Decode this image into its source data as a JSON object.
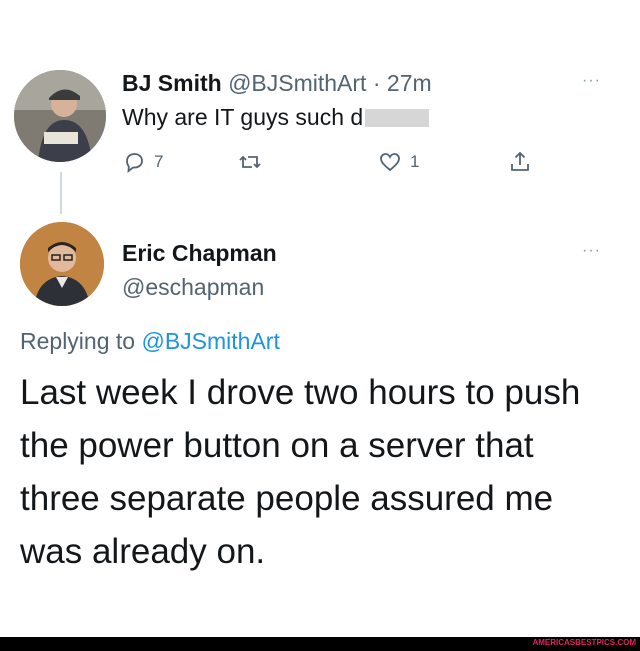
{
  "tweet1": {
    "name": "BJ Smith",
    "handle": "@BJSmithArt",
    "separator": "·",
    "time": "27m",
    "text": "Why are IT guys such d",
    "more": "···",
    "replies": "7",
    "likes": "1"
  },
  "tweet2": {
    "name": "Eric Chapman",
    "handle": "@eschapman",
    "more": "···",
    "replying_prefix": "Replying to",
    "replying_to": "@BJSmithArt",
    "text": "Last week I drove two hours to push the power button on a server that three separate people assured me was already on."
  },
  "watermark": "AMERICASBESTPICS.COM",
  "icons": [
    "reply-icon",
    "retweet-icon",
    "like-icon",
    "share-icon"
  ],
  "colors": {
    "link": "#1b95e0",
    "muted": "#536471",
    "text": "#14171a"
  }
}
